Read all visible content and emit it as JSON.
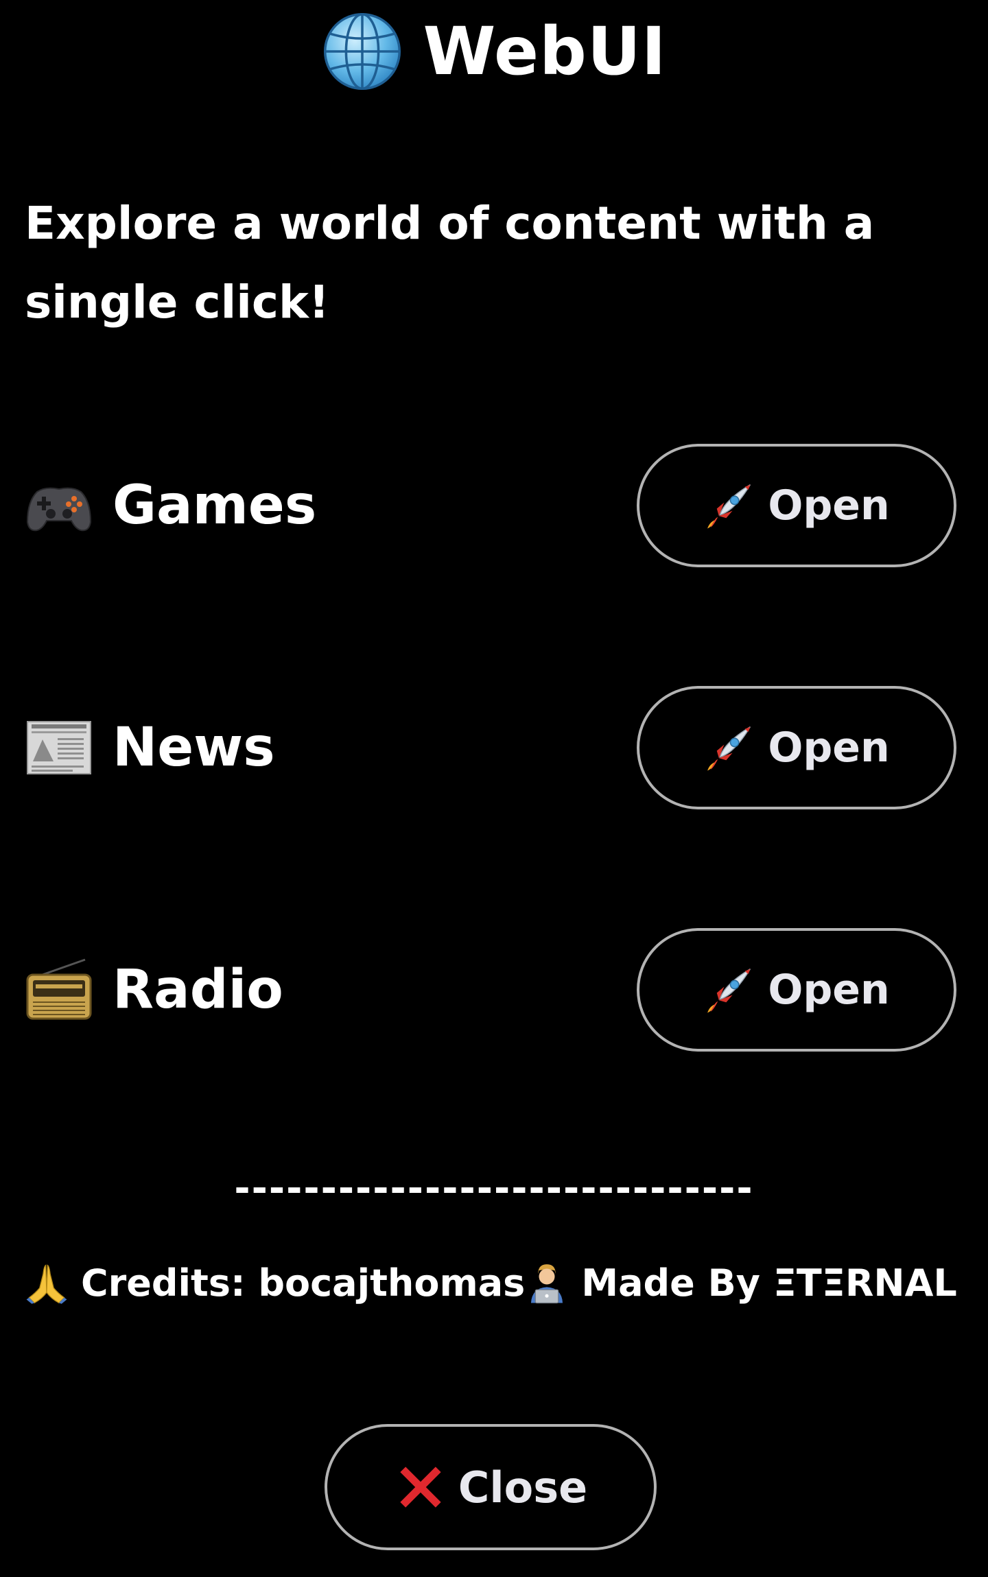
{
  "header": {
    "icon": "globe-icon",
    "title": "WebUI"
  },
  "tagline": "Explore a world of content with a single click!",
  "items": [
    {
      "icon": "game-controller-icon",
      "label": "Games",
      "button_icon": "rocket-icon",
      "button_label": "Open"
    },
    {
      "icon": "newspaper-icon",
      "label": "News",
      "button_icon": "rocket-icon",
      "button_label": "Open"
    },
    {
      "icon": "radio-icon",
      "label": "Radio",
      "button_icon": "rocket-icon",
      "button_label": "Open"
    }
  ],
  "divider": "------------------------------",
  "footer": {
    "credits": {
      "icon": "praying-hands-icon",
      "text": "Credits: bocajthomas"
    },
    "made_by": {
      "icon": "technologist-icon",
      "text": "Made By ΞTΞRNAL"
    }
  },
  "close_button": {
    "icon": "cross-mark-icon",
    "label": "Close"
  },
  "colors": {
    "background": "#000000",
    "text": "#ffffff",
    "button_border": "#b3b3b3",
    "close_x": "#e0282e"
  }
}
